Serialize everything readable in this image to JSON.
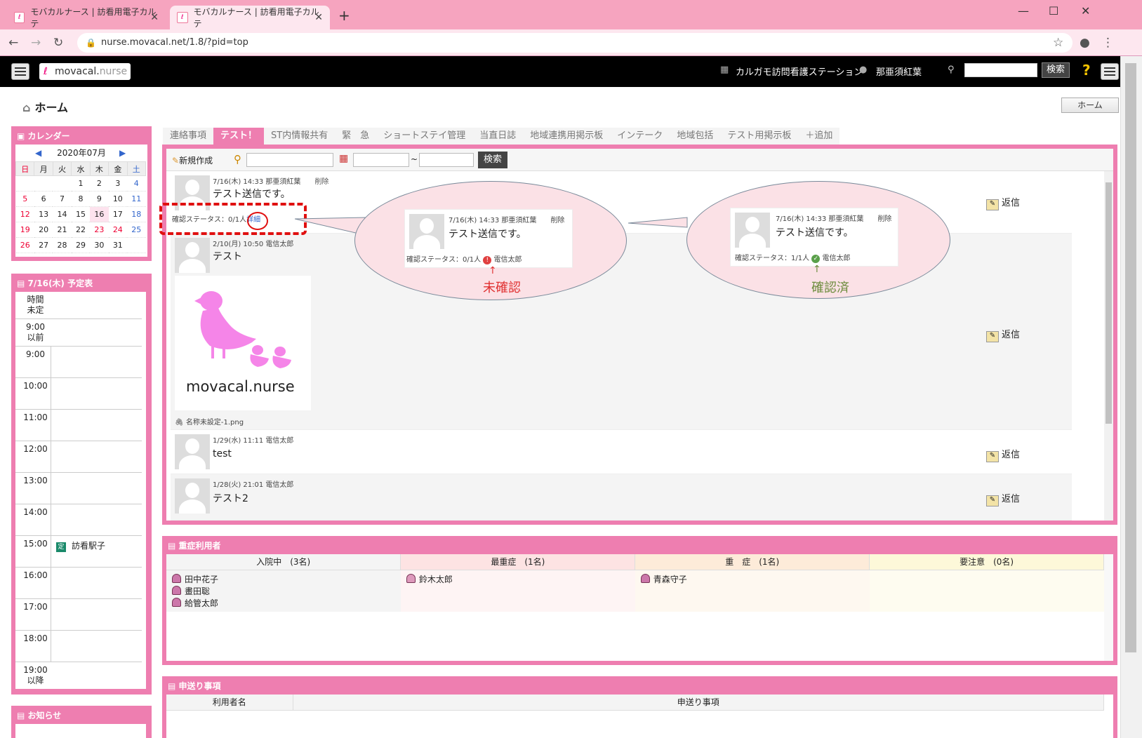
{
  "browser": {
    "tabs": [
      {
        "title": "モバカルナース | 訪看用電子カルテ"
      },
      {
        "title": "モバカルナース | 訪看用電子カルテ"
      }
    ],
    "url": "nurse.movacal.net/1.8/?pid=top"
  },
  "header": {
    "logo_main": "movacal.",
    "logo_sub": "nurse",
    "station": "カルガモ訪問看護ステーション",
    "user": "那亜須紅葉",
    "search_label": "検索"
  },
  "page": {
    "title": "ホーム",
    "home_button": "ホーム"
  },
  "calendar": {
    "title": "カレンダー",
    "month": "2020年07月",
    "weekdays": [
      "日",
      "月",
      "火",
      "水",
      "木",
      "金",
      "土"
    ],
    "weeks": [
      [
        "",
        "",
        "",
        "1",
        "2",
        "3",
        "4"
      ],
      [
        "5",
        "6",
        "7",
        "8",
        "9",
        "10",
        "11"
      ],
      [
        "12",
        "13",
        "14",
        "15",
        "16",
        "17",
        "18"
      ],
      [
        "19",
        "20",
        "21",
        "22",
        "23",
        "24",
        "25"
      ],
      [
        "26",
        "27",
        "28",
        "29",
        "30",
        "31",
        ""
      ]
    ]
  },
  "schedule": {
    "title": "7/16(木) 予定表",
    "slots": [
      "時間\n未定",
      "9:00\n以前",
      "9:00",
      "10:00",
      "11:00",
      "12:00",
      "13:00",
      "14:00",
      "15:00",
      "16:00",
      "17:00",
      "18:00",
      "19:00\n以降"
    ],
    "event": {
      "badge": "定",
      "name": "訪看駅子"
    }
  },
  "notice": {
    "title": "お知らせ"
  },
  "board": {
    "tabs": [
      "連絡事項",
      "テスト！",
      "ST内情報共有",
      "緊　急",
      "ショートステイ管理",
      "当直日誌",
      "地域連携用掲示板",
      "インテーク",
      "地域包括",
      "テスト用掲示板",
      "＋追加"
    ],
    "new_label": "新規作成",
    "search_label": "検索",
    "range_sep": "~",
    "messages": [
      {
        "meta": "7/16(木) 14:33 那亜須紅葉",
        "delete": "削除",
        "body": "テスト送信です。",
        "status": "確認ステータス：0/1人",
        "detail": "詳細",
        "reply": "返信"
      },
      {
        "meta": "2/10(月) 10:50 電信太郎",
        "body": "テスト",
        "image_text": "movacal.nurse",
        "attachment": "名称未設定-1.png",
        "reply": "返信"
      },
      {
        "meta": "1/29(水) 11:11 電信太郎",
        "body": "test",
        "reply": "返信"
      },
      {
        "meta": "1/28(火) 21:01 電信太郎",
        "body": "テスト2",
        "reply": "返信"
      }
    ],
    "callouts": [
      {
        "meta": "7/16(木) 14:33 那亜須紅葉",
        "delete": "削除",
        "body": "テスト送信です。",
        "status": "確認ステータス：0/1人",
        "confirmer": "電信太郎",
        "label": "未確認",
        "color": "#e03030"
      },
      {
        "meta": "7/16(木) 14:33 那亜須紅葉",
        "delete": "削除",
        "body": "テスト送信です。",
        "status": "確認ステータス：1/1人",
        "confirmer": "電信太郎",
        "label": "確認済",
        "color": "#6c8c3c"
      }
    ]
  },
  "severe": {
    "title": "重症利用者",
    "columns": [
      {
        "label": "入院中　(3名)",
        "patients": [
          "田中花子",
          "畫田聡",
          "給管太郎"
        ]
      },
      {
        "label": "最重症　(1名)",
        "patients": [
          "鈴木太郎"
        ]
      },
      {
        "label": "重　症　(1名)",
        "patients": [
          "青森守子"
        ]
      },
      {
        "label": "要注意　(0名)",
        "patients": []
      }
    ]
  },
  "handover": {
    "title": "申送り事項",
    "col_user": "利用者名",
    "col_item": "申送り事項"
  }
}
